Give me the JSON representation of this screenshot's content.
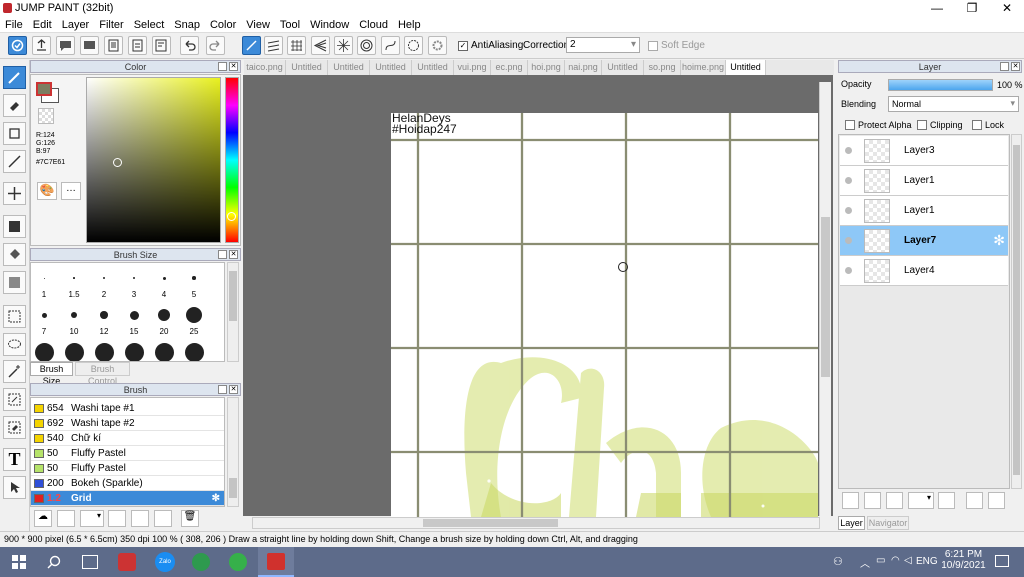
{
  "window": {
    "title": "JUMP PAINT (32bit)",
    "minimize": "—",
    "maximize": "❐",
    "close": "✕"
  },
  "menu": [
    "File",
    "Edit",
    "Layer",
    "Filter",
    "Select",
    "Snap",
    "Color",
    "View",
    "Tool",
    "Window",
    "Cloud",
    "Help"
  ],
  "toolbar": {
    "antialias_label": "AntiAliasing",
    "correction_label": "Correction",
    "correction_value": "2",
    "soft_edge_label": "Soft Edge"
  },
  "color_panel": {
    "title": "Color",
    "r": "R:124",
    "g": "G:126",
    "b": "B:97",
    "hex": "#7C7E61",
    "fg": "#7c7e61",
    "bg": "#ffffff"
  },
  "brush_size_panel": {
    "title": "Brush Size",
    "tab_size": "Brush Size",
    "tab_control": "Brush Control",
    "sizes": [
      "1",
      "1.5",
      "2",
      "3",
      "4",
      "5",
      "7",
      "10",
      "12",
      "15",
      "20",
      "25",
      "",
      "",
      "",
      "",
      "",
      ""
    ]
  },
  "brush_panel": {
    "title": "Brush",
    "items": [
      {
        "size": "654",
        "name": "Washi tape #1",
        "color": "#f4d400"
      },
      {
        "size": "692",
        "name": "Washi tape #2",
        "color": "#f4d400"
      },
      {
        "size": "540",
        "name": "Chữ kí",
        "color": "#f4d400"
      },
      {
        "size": "50",
        "name": "Fluffy Pastel",
        "color": "#b6e36a"
      },
      {
        "size": "50",
        "name": "Fluffy Pastel",
        "color": "#b6e36a"
      },
      {
        "size": "200",
        "name": "Bokeh (Sparkle)",
        "color": "#2f4fd8"
      },
      {
        "size": "1.2",
        "name": "Grid",
        "color": "#e02020"
      }
    ]
  },
  "tabs": [
    "taico.png",
    "Untitled",
    "Untitled",
    "Untitled",
    "Untitled",
    "vui.png",
    "ec.png",
    "hoi.png",
    "nai.png",
    "Untitled",
    "so.png",
    "hoime.png",
    "Untitled"
  ],
  "canvas": {
    "watermark1": "HelanDeys",
    "watermark2": "#Hoidap247"
  },
  "layer_panel": {
    "title": "Layer",
    "opacity_label": "Opacity",
    "opacity_value": "100 %",
    "opacity_fraction": 1.0,
    "blending_label": "Blending",
    "blending_value": "Normal",
    "protect_alpha": "Protect Alpha",
    "clipping": "Clipping",
    "lock": "Lock",
    "layers": [
      "Layer3",
      "Layer1",
      "Layer1",
      "Layer7",
      "Layer4"
    ],
    "tab_layer": "Layer",
    "tab_navigator": "Navigator"
  },
  "statusbar": {
    "text": "900 * 900 pixel   (6.5 * 6.5cm)   350 dpi   100 %   ( 308, 206 )   Draw a straight line by holding down Shift, Change a brush size by holding down Ctrl, Alt, and dragging"
  },
  "taskbar": {
    "lang": "ENG",
    "time": "6:21 PM",
    "date": "10/9/2021",
    "zalo": "Zalo"
  }
}
